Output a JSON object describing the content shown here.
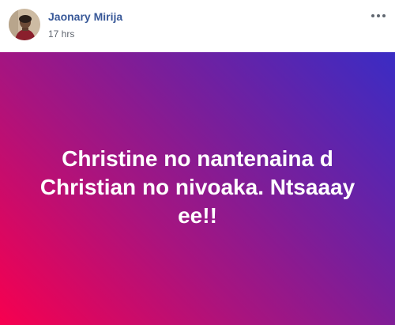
{
  "post": {
    "author": {
      "name": "Jaonary Mirija",
      "avatar_icon": "profile-photo"
    },
    "timestamp": "17 hrs",
    "more_icon": "more-options-icon",
    "status": {
      "text": "Christine no nantenaina d Christian no nivoaka. Ntsaaay ee!!",
      "text_color": "#ffffff",
      "background": {
        "gradient_from": "#f7004f",
        "gradient_mid": "#7a1e9a",
        "gradient_to": "#3a2cc4"
      }
    },
    "colors": {
      "author_name": "#385898",
      "timestamp": "#616770"
    }
  }
}
